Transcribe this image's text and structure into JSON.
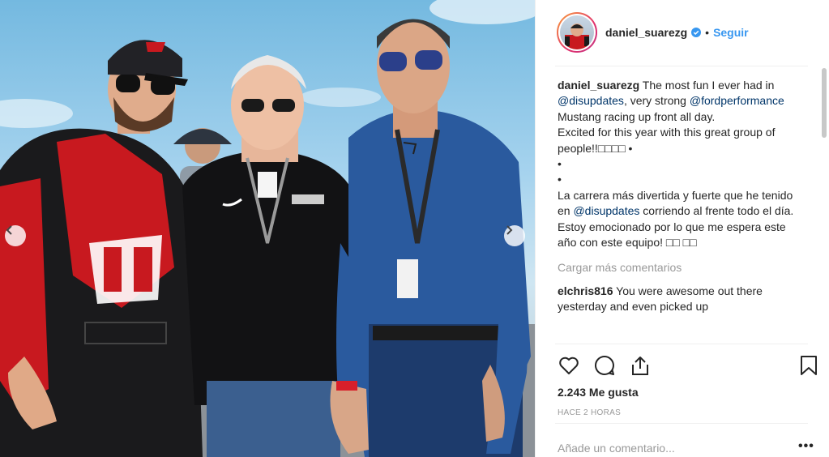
{
  "post": {
    "username": "daniel_suarezg",
    "follow_label": "Seguir",
    "dot": "•",
    "caption": {
      "username": "daniel_suarezg",
      "part1": " The most fun I ever had in ",
      "mention1": "@disupdates",
      "part2": ", very strong ",
      "mention2": "@fordperformance",
      "part3": " Mustang racing up front all day.",
      "line2": "Excited for this year with this great group of people!!□□□□ •",
      "bullet1": "•",
      "bullet2": "•",
      "es_part1": "La carrera más divertida y fuerte que he tenido en ",
      "es_mention": "@disupdates",
      "es_part2": " corriendo al frente todo el día. Estoy emocionado por lo que me espera este año con este equipo! □□ □□"
    },
    "load_more": "Cargar más comentarios",
    "comment": {
      "username": "elchris816",
      "text": " You were awesome out there yesterday and even picked up"
    },
    "likes": "2.243 Me gusta",
    "time_ago": "HACE 2 HORAS",
    "add_comment_placeholder": "Añade un comentario...",
    "more_options": "•••"
  },
  "icons": {
    "verified": "verified-badge-icon",
    "like": "heart-icon",
    "comment": "comment-icon",
    "share": "share-icon",
    "save": "bookmark-icon",
    "prev": "chevron-left-icon",
    "next": "chevron-right-icon"
  },
  "colors": {
    "link": "#3897f0",
    "mention": "#003569",
    "muted": "#999999",
    "text": "#262626"
  }
}
